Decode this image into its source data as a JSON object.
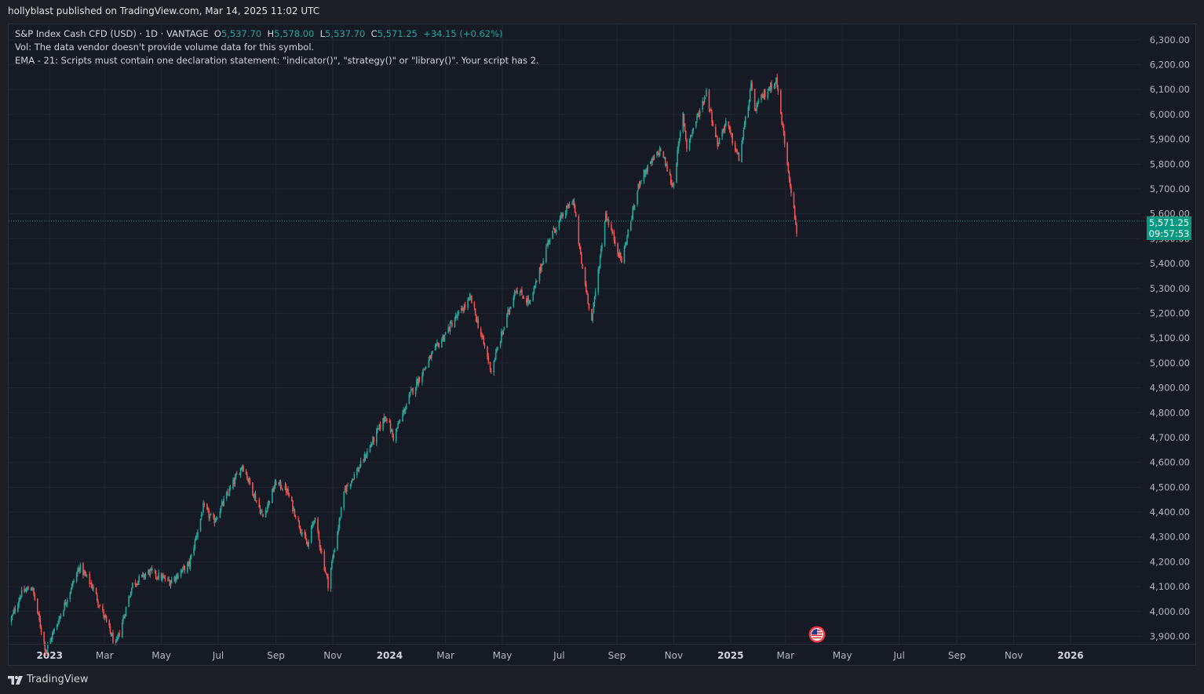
{
  "header": {
    "published": "hollyblast published on TradingView.com, Mar 14, 2025 11:02 UTC"
  },
  "legend": {
    "symbol": "S&P Index Cash CFD (USD) · 1D · VANTAGE",
    "open_label": "O",
    "open": "5,537.70",
    "high_label": "H",
    "high": "5,578.00",
    "low_label": "L",
    "low": "5,537.70",
    "close_label": "C",
    "close": "5,571.25",
    "change": "+34.15 (+0.62%)",
    "vol_line": "Vol: The data vendor doesn't provide volume data for this symbol.",
    "ema_line": "EMA - 21: Scripts must contain one declaration statement: \"indicator()\", \"strategy()\" or \"library()\". Your script has 2."
  },
  "price_tag": {
    "price": "5,571.25",
    "countdown": "09:57:53"
  },
  "footer": {
    "brand": "TradingView"
  },
  "colors": {
    "up": "#26a69a",
    "down": "#ef5350",
    "background": "#161a25",
    "grid": "#222631",
    "axis_text": "#b2b5be"
  },
  "icons": {
    "flag": "us-flag-icon",
    "logo": "tradingview-logo-icon"
  },
  "chart_data": {
    "type": "candlestick",
    "ylim": [
      3870,
      6350
    ],
    "y_ticks": [
      "3,900.00",
      "4,000.00",
      "4,100.00",
      "4,200.00",
      "4,300.00",
      "4,400.00",
      "4,500.00",
      "4,600.00",
      "4,700.00",
      "4,800.00",
      "4,900.00",
      "5,000.00",
      "5,100.00",
      "5,200.00",
      "5,300.00",
      "5,400.00",
      "5,500.00",
      "5,600.00",
      "5,700.00",
      "5,800.00",
      "5,900.00",
      "6,000.00",
      "6,100.00",
      "6,200.00",
      "6,300.00"
    ],
    "y_tick_values": [
      3900,
      4000,
      4100,
      4200,
      4300,
      4400,
      4500,
      4600,
      4700,
      4800,
      4900,
      5000,
      5100,
      5200,
      5300,
      5400,
      5500,
      5600,
      5700,
      5800,
      5900,
      6000,
      6100,
      6200,
      6300
    ],
    "x_ticks": [
      {
        "label": "2023",
        "date": "2023-01-01",
        "bold": true
      },
      {
        "label": "Mar",
        "date": "2023-03-01",
        "bold": false
      },
      {
        "label": "May",
        "date": "2023-05-01",
        "bold": false
      },
      {
        "label": "Jul",
        "date": "2023-07-01",
        "bold": false
      },
      {
        "label": "Sep",
        "date": "2023-09-01",
        "bold": false
      },
      {
        "label": "Nov",
        "date": "2023-11-01",
        "bold": false
      },
      {
        "label": "2024",
        "date": "2024-01-01",
        "bold": true
      },
      {
        "label": "Mar",
        "date": "2024-03-01",
        "bold": false
      },
      {
        "label": "May",
        "date": "2024-05-01",
        "bold": false
      },
      {
        "label": "Jul",
        "date": "2024-07-01",
        "bold": false
      },
      {
        "label": "Sep",
        "date": "2024-09-01",
        "bold": false
      },
      {
        "label": "Nov",
        "date": "2024-11-01",
        "bold": false
      },
      {
        "label": "2025",
        "date": "2025-01-01",
        "bold": true
      },
      {
        "label": "Mar",
        "date": "2025-03-01",
        "bold": false
      },
      {
        "label": "May",
        "date": "2025-05-01",
        "bold": false
      },
      {
        "label": "Jul",
        "date": "2025-07-01",
        "bold": false
      },
      {
        "label": "Sep",
        "date": "2025-09-01",
        "bold": false
      },
      {
        "label": "Nov",
        "date": "2025-11-01",
        "bold": false
      },
      {
        "label": "2026",
        "date": "2026-01-01",
        "bold": true
      }
    ],
    "x_range": [
      "2022-11-18",
      "2026-05-15"
    ],
    "last_price": 5571.25,
    "series": [
      {
        "name": "S&P Index Cash CFD",
        "path": [
          [
            "2022-11-20",
            3960
          ],
          [
            "2022-12-01",
            4070
          ],
          [
            "2022-12-13",
            4100
          ],
          [
            "2022-12-28",
            3840
          ],
          [
            "2023-01-13",
            3990
          ],
          [
            "2023-02-02",
            4180
          ],
          [
            "2023-02-16",
            4100
          ],
          [
            "2023-03-13",
            3860
          ],
          [
            "2023-03-31",
            4110
          ],
          [
            "2023-04-18",
            4160
          ],
          [
            "2023-05-10",
            4120
          ],
          [
            "2023-05-31",
            4190
          ],
          [
            "2023-06-15",
            4420
          ],
          [
            "2023-06-26",
            4360
          ],
          [
            "2023-07-27",
            4590
          ],
          [
            "2023-08-18",
            4380
          ],
          [
            "2023-09-01",
            4520
          ],
          [
            "2023-09-12",
            4490
          ],
          [
            "2023-10-05",
            4260
          ],
          [
            "2023-10-12",
            4380
          ],
          [
            "2023-10-27",
            4110
          ],
          [
            "2023-11-14",
            4490
          ],
          [
            "2023-12-01",
            4590
          ],
          [
            "2023-12-28",
            4790
          ],
          [
            "2024-01-05",
            4700
          ],
          [
            "2024-01-24",
            4880
          ],
          [
            "2024-02-15",
            5030
          ],
          [
            "2024-03-08",
            5160
          ],
          [
            "2024-03-28",
            5260
          ],
          [
            "2024-04-19",
            4970
          ],
          [
            "2024-05-15",
            5300
          ],
          [
            "2024-05-31",
            5240
          ],
          [
            "2024-06-20",
            5500
          ],
          [
            "2024-07-16",
            5660
          ],
          [
            "2024-07-25",
            5400
          ],
          [
            "2024-08-05",
            5170
          ],
          [
            "2024-08-20",
            5600
          ],
          [
            "2024-09-06",
            5410
          ],
          [
            "2024-09-26",
            5740
          ],
          [
            "2024-10-18",
            5860
          ],
          [
            "2024-10-31",
            5710
          ],
          [
            "2024-11-11",
            6000
          ],
          [
            "2024-11-15",
            5870
          ],
          [
            "2024-12-06",
            6090
          ],
          [
            "2024-12-18",
            5880
          ],
          [
            "2024-12-27",
            5970
          ],
          [
            "2025-01-10",
            5820
          ],
          [
            "2025-01-23",
            6110
          ],
          [
            "2025-01-27",
            6020
          ],
          [
            "2025-02-06",
            6080
          ],
          [
            "2025-02-19",
            6140
          ],
          [
            "2025-03-04",
            5780
          ],
          [
            "2025-03-13",
            5530
          ],
          [
            "2025-03-14",
            5571
          ]
        ]
      }
    ]
  }
}
